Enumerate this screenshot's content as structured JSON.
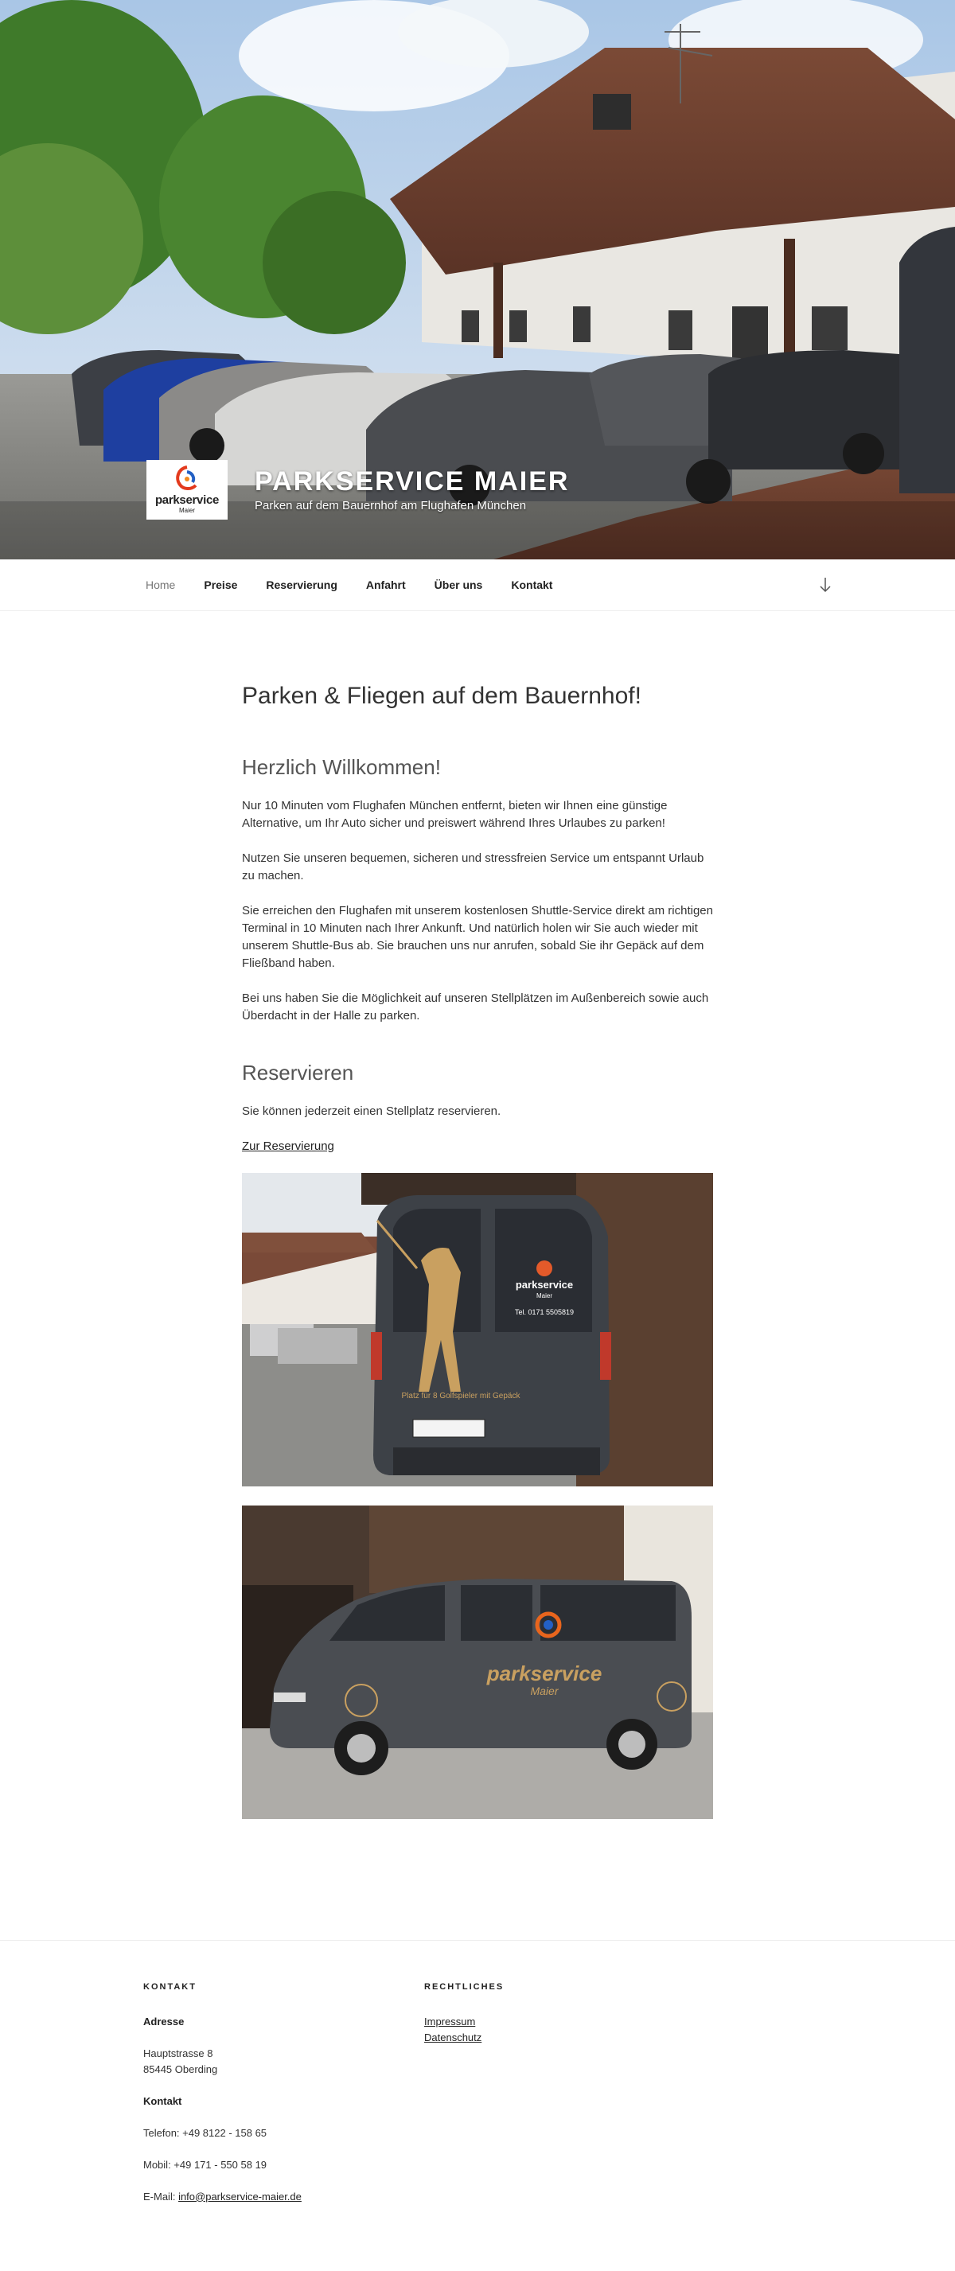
{
  "header": {
    "site_title": "PARKSERVICE MAIER",
    "site_description": "Parken auf dem Bauernhof am Flughafen München",
    "logo_text": "parkservice",
    "logo_subtext": "Maier"
  },
  "nav": {
    "items": [
      {
        "label": "Home"
      },
      {
        "label": "Preise"
      },
      {
        "label": "Reservierung"
      },
      {
        "label": "Anfahrt"
      },
      {
        "label": "Über uns"
      },
      {
        "label": "Kontakt"
      }
    ],
    "scroll_icon": "arrow-down-icon"
  },
  "main": {
    "title": "Parken & Fliegen auf dem Bauernhof!",
    "welcome_heading": "Herzlich Willkommen!",
    "paragraphs": [
      "Nur 10 Minuten vom Flughafen München entfernt, bieten wir Ihnen eine günstige Alternative, um Ihr Auto sicher und preiswert während Ihres Urlaubes zu parken!",
      "Nutzen Sie unseren bequemen, sicheren und stressfreien Service um entspannt Urlaub zu machen.",
      "Sie erreichen den Flughafen mit unserem kostenlosen Shuttle-Service direkt am richtigen Terminal in 10 Minuten nach Ihrer Ankunft. Und natürlich holen wir Sie auch wieder mit unserem Shuttle-Bus ab. Sie brauchen uns nur anrufen, sobald Sie ihr Gepäck auf dem Fließband haben.",
      "Bei uns haben Sie die Möglichkeit auf unseren Stellplätzen im Außenbereich sowie auch Überdacht in der Halle zu parken."
    ],
    "reserve_heading": "Reservieren",
    "reserve_text": "Sie können jederzeit einen Stellplatz reservieren.",
    "reserve_link": "Zur Reservierung",
    "van1": {
      "logo_text": "parkservice",
      "logo_sub": "Maier",
      "phone": "Tel. 0171 5505819",
      "slogan": "Platz für 8 Golfspieler mit Gepäck"
    },
    "van2": {
      "brand_text": "parkservice",
      "brand_sub": "Maier"
    }
  },
  "footer": {
    "kontakt_title": "KONTAKT",
    "adresse_label": "Adresse",
    "street": "Hauptstrasse 8",
    "city": "85445 Oberding",
    "kontakt_label": "Kontakt",
    "telefon": "Telefon: +49 8122 - 158 65",
    "mobil": "Mobil: +49 171 - 550 58 19",
    "email_prefix": "E-Mail: ",
    "email": "info@parkservice-maier.de",
    "rechtliches_title": "RECHTLICHES",
    "impressum": "Impressum",
    "datenschutz": "Datenschutz"
  }
}
